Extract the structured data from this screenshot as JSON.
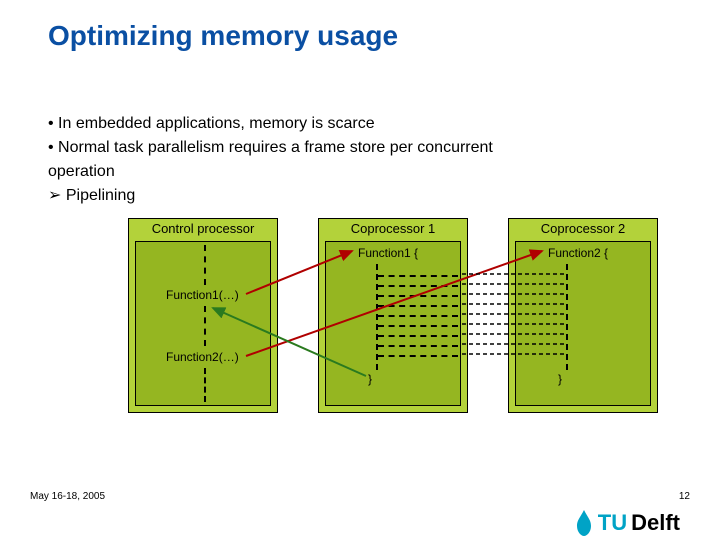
{
  "title": "Optimizing memory usage",
  "bullets": {
    "l1": "In embedded applications, memory is scarce",
    "l2": "Normal task parallelism requires a frame store per concurrent",
    "l2b": "operation",
    "l3": "Pipelining"
  },
  "diagram": {
    "control": {
      "header": "Control processor",
      "call1": "Function1(…)",
      "call2": "Function2(…)"
    },
    "cop1": {
      "header": "Coprocessor 1",
      "open": "Function1 {",
      "close": "}"
    },
    "cop2": {
      "header": "Coprocessor 2",
      "open": "Function2 {",
      "close": "}"
    }
  },
  "footer": {
    "date": "May 16-18, 2005",
    "page": "12",
    "logo_text_1": "TU",
    "logo_text_2": "Delft"
  }
}
